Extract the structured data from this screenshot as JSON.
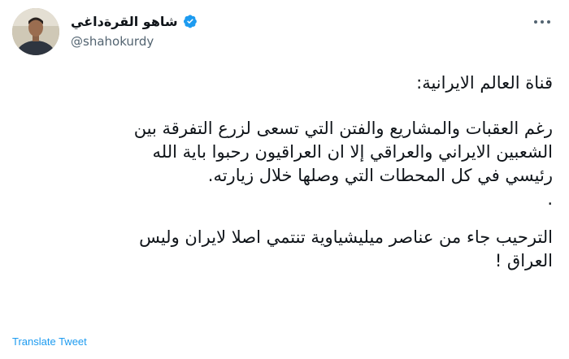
{
  "author": {
    "display_name": "شاهو القرةداغي",
    "handle": "@shahokurdy",
    "verified": true
  },
  "icons": {
    "avatar": "profile-photo",
    "verified": "verified-badge-icon",
    "more": "more-options-icon"
  },
  "tweet": {
    "lines": [
      "قناة العالم الايرانية:",
      "رغم العقبات والمشاريع والفتن التي تسعى لزرع التفرقة بين",
      "الشعبين الايراني والعراقي إلا ان العراقيون رحبوا باية الله",
      "رئيسي في كل المحطات التي وصلها خلال زيارته.",
      ".",
      "الترحيب جاء من عناصر ميليشياوية تنتمي اصلا لايران وليس",
      "العراق !"
    ]
  },
  "translate_label": "Translate Tweet",
  "colors": {
    "accent": "#1d9bf0",
    "text": "#0f1419",
    "secondary": "#536471"
  }
}
